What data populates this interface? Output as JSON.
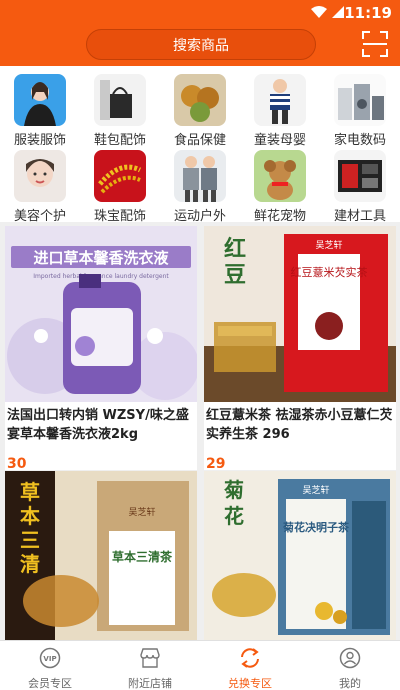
{
  "status": {
    "time": "11:19"
  },
  "header": {
    "search_label": "搜索商品"
  },
  "categories": [
    {
      "label": "服装服饰",
      "icon": "woman-fashion-photo"
    },
    {
      "label": "鞋包配饰",
      "icon": "handbag-photo"
    },
    {
      "label": "食品保健",
      "icon": "pastry-photo"
    },
    {
      "label": "童装母婴",
      "icon": "kids-clothes-photo"
    },
    {
      "label": "家电数码",
      "icon": "appliances-photo"
    },
    {
      "label": "美容个护",
      "icon": "beauty-photo"
    },
    {
      "label": "珠宝配饰",
      "icon": "jewelry-photo"
    },
    {
      "label": "运动户外",
      "icon": "sportswear-photo"
    },
    {
      "label": "鲜花宠物",
      "icon": "dog-photo"
    },
    {
      "label": "建材工具",
      "icon": "toolkit-photo"
    }
  ],
  "products": [
    {
      "title": "法国出口转内销 WZSY/味之盛宴草本馨香洗衣液2kg",
      "price": "30",
      "image_text": "进口草本馨香洗衣液",
      "image_subtext": "Imported herbal fragrance laundry detergent"
    },
    {
      "title": "红豆薏米茶 祛湿茶赤小豆薏仁芡实养生茶 296",
      "price": "29",
      "image_text": "红豆薏米芡实茶",
      "image_brand": "吴芝轩"
    },
    {
      "title": "",
      "price": "",
      "image_text": "草本三清茶",
      "image_brand": "吴芝轩"
    },
    {
      "title": "",
      "price": "",
      "image_text": "菊花决明子茶",
      "image_brand": "吴芝轩"
    }
  ],
  "bottom_nav": [
    {
      "label": "会员专区",
      "icon": "vip-icon"
    },
    {
      "label": "附近店铺",
      "icon": "store-icon"
    },
    {
      "label": "兑换专区",
      "icon": "exchange-icon",
      "active": true
    },
    {
      "label": "我的",
      "icon": "user-icon"
    }
  ],
  "colors": {
    "accent": "#f55a10",
    "background": "#efefef"
  }
}
